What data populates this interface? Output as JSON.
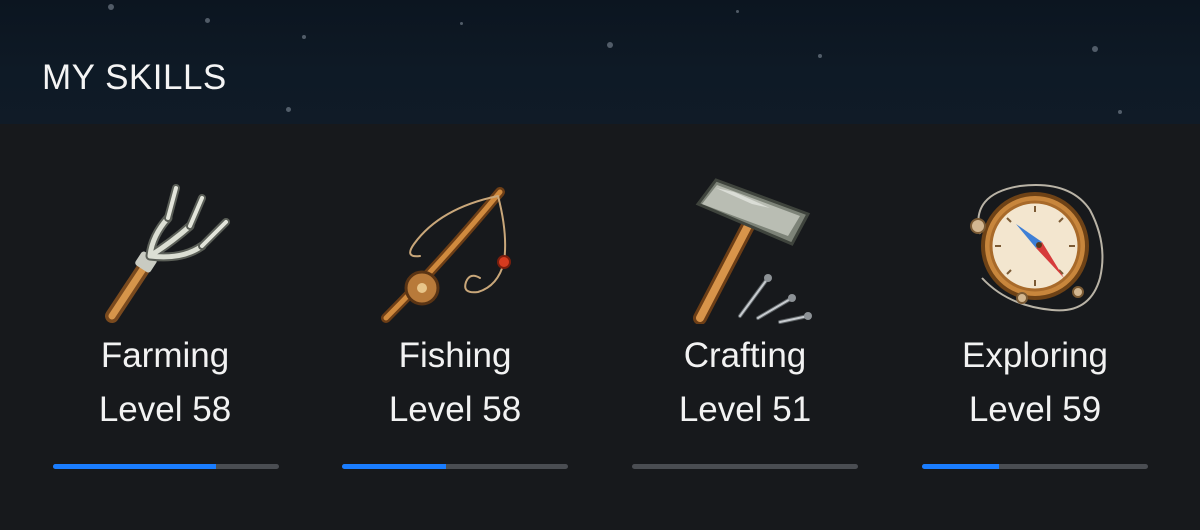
{
  "header": {
    "title": "MY SKILLS"
  },
  "colors": {
    "accent": "#1a7dff",
    "track": "#4a4d52",
    "background": "#17191c"
  },
  "skills": [
    {
      "name": "Farming",
      "level_text": "Level 58",
      "progress": 0.72,
      "icon": "pitchfork-icon"
    },
    {
      "name": "Fishing",
      "level_text": "Level 58",
      "progress": 0.46,
      "icon": "fishing-rod-icon"
    },
    {
      "name": "Crafting",
      "level_text": "Level 51",
      "progress": 0.0,
      "icon": "hammer-nails-icon"
    },
    {
      "name": "Exploring",
      "level_text": "Level 59",
      "progress": 0.34,
      "icon": "compass-icon"
    }
  ]
}
